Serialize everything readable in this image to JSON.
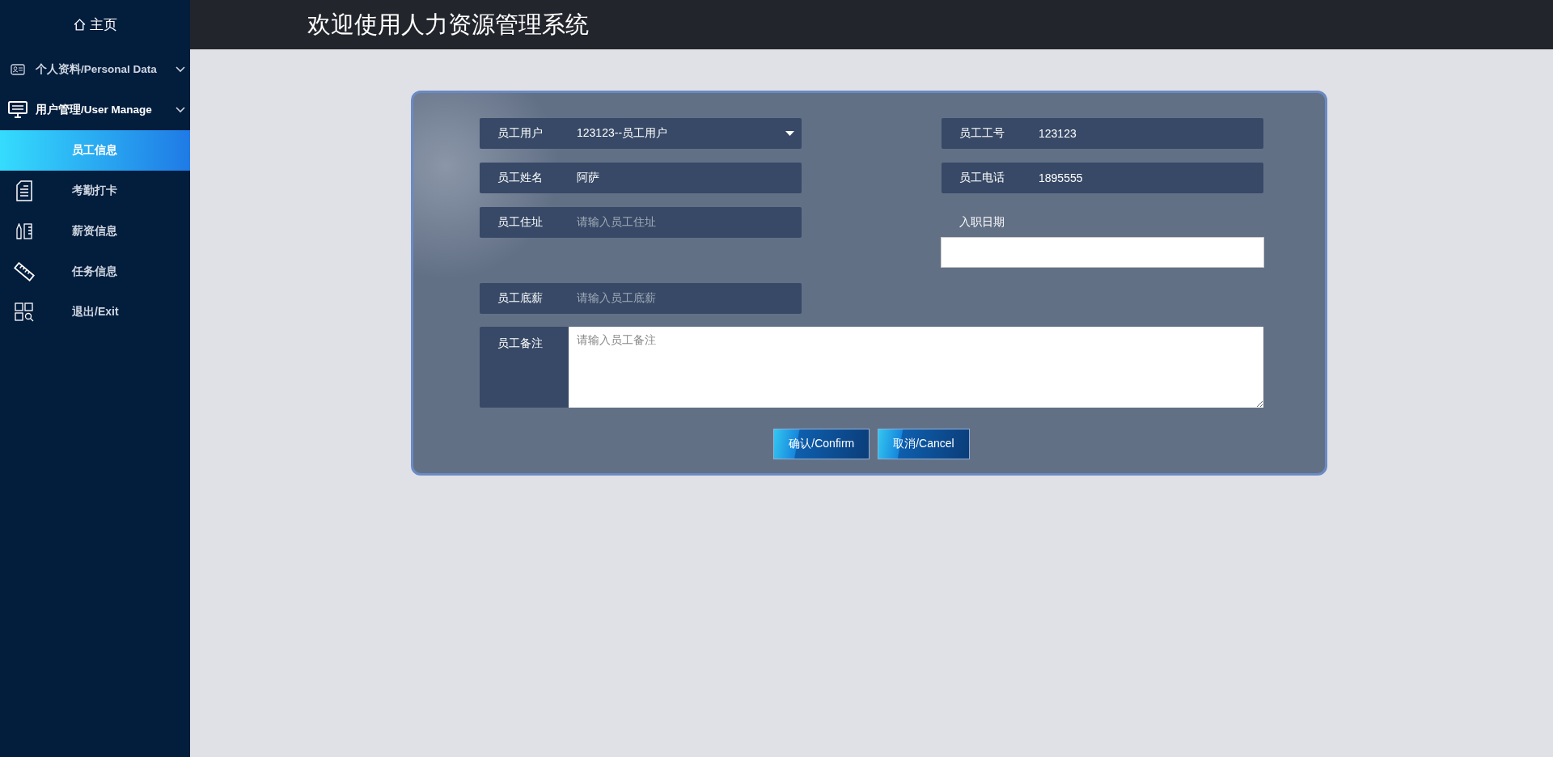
{
  "sidebar": {
    "home": "主页",
    "items": [
      {
        "kind": "group",
        "label": "个人资料/Personal Data",
        "selected": false
      },
      {
        "kind": "group",
        "label": "用户管理/User Manage",
        "selected": false
      },
      {
        "kind": "link",
        "label": "员工信息",
        "selected": true
      },
      {
        "kind": "link",
        "label": "考勤打卡",
        "selected": false
      },
      {
        "kind": "link",
        "label": "薪资信息",
        "selected": false
      },
      {
        "kind": "link",
        "label": "任务信息",
        "selected": false
      },
      {
        "kind": "link",
        "label": "退出/Exit",
        "selected": false
      }
    ]
  },
  "header": {
    "title": "欢迎使用人力资源管理系统"
  },
  "form": {
    "rows": [
      [
        {
          "kind": "select",
          "label": "员工用户",
          "value": "123123--员工用户"
        },
        {
          "kind": "text",
          "label": "员工工号",
          "value": "123123"
        }
      ],
      [
        {
          "kind": "text",
          "label": "员工姓名",
          "value": "阿萨"
        },
        {
          "kind": "text",
          "label": "员工电话",
          "value": "1895555"
        }
      ],
      [
        {
          "kind": "text",
          "label": "员工住址",
          "placeholder": "请输入员工住址"
        },
        {
          "kind": "date",
          "label": "入职日期"
        }
      ],
      [
        {
          "kind": "text",
          "label": "员工底薪",
          "placeholder": "请输入员工底薪"
        }
      ]
    ],
    "remark": {
      "label": "员工备注",
      "placeholder": "请输入员工备注"
    },
    "buttons": [
      "确认/Confirm",
      "取消/Cancel"
    ]
  }
}
